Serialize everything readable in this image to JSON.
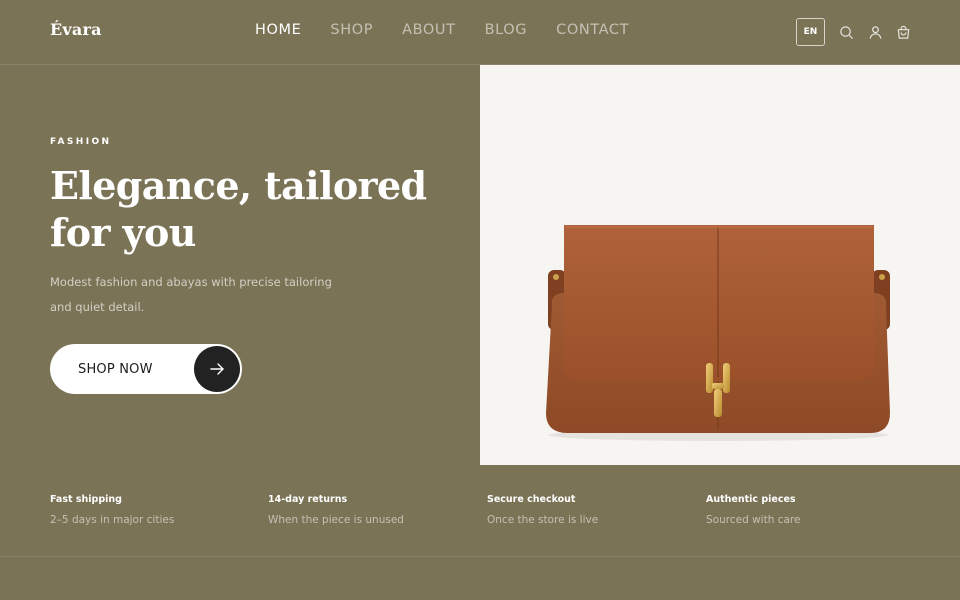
{
  "brand": {
    "name": "Évara"
  },
  "nav": {
    "items": [
      {
        "label": "HOME",
        "active": true
      },
      {
        "label": "SHOP",
        "active": false
      },
      {
        "label": "ABOUT",
        "active": false
      },
      {
        "label": "BLOG",
        "active": false
      },
      {
        "label": "CONTACT",
        "active": false
      }
    ]
  },
  "header_actions": {
    "language": "EN",
    "icons": [
      "search-icon",
      "user-icon",
      "cart-icon"
    ]
  },
  "hero": {
    "eyebrow": "FASHION",
    "title": "Elegance, tailored for you",
    "subtitle": "Modest fashion and abayas with precise tailoring and quiet detail.",
    "cta_label": "SHOP NOW",
    "cta_icon": "arrow-right-icon",
    "image_subject": "brown leather handbag with gold clasp"
  },
  "features": [
    {
      "title": "Fast shipping",
      "desc": "2–5 days in major cities"
    },
    {
      "title": "14-day returns",
      "desc": "When the piece is unused"
    },
    {
      "title": "Secure checkout",
      "desc": "Once the store is live"
    },
    {
      "title": "Authentic pieces",
      "desc": "Sourced with care"
    }
  ],
  "colors": {
    "background": "#7b7356",
    "text": "#ffffff",
    "button_bg": "#ffffff",
    "button_circle": "#222222",
    "image_bg": "#f7f5f2",
    "bag_leather": "#a4582f"
  }
}
